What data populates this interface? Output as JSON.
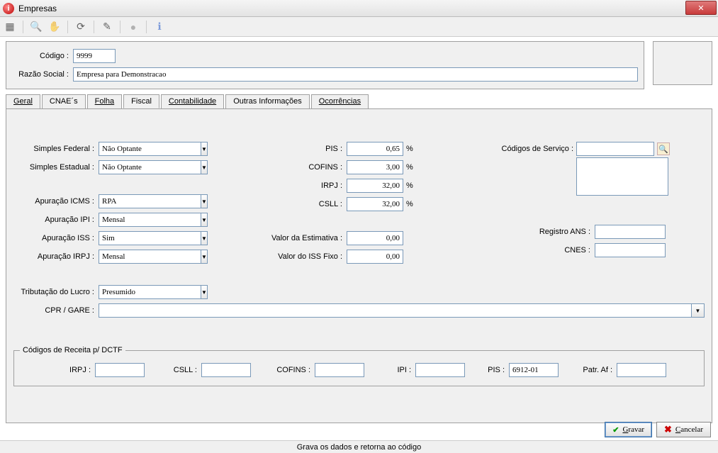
{
  "window": {
    "title": "Empresas",
    "icon_letter": "i"
  },
  "header": {
    "codigo_label": "Código :",
    "codigo_value": "9999",
    "razao_label": "Razão Social :",
    "razao_value": "Empresa para Demonstracao"
  },
  "tabs": {
    "geral": "Geral",
    "cnaes": "CNAE´s",
    "folha": "Folha",
    "fiscal": "Fiscal",
    "contabilidade": "Contabilidade",
    "outras": "Outras Informações",
    "ocorrencias": "Ocorrências"
  },
  "fiscal": {
    "simples_federal_label": "Simples Federal :",
    "simples_federal_value": "Não Optante",
    "simples_estadual_label": "Simples Estadual :",
    "simples_estadual_value": "Não Optante",
    "apuracao_icms_label": "Apuração ICMS :",
    "apuracao_icms_value": "RPA",
    "apuracao_ipi_label": "Apuração IPI :",
    "apuracao_ipi_value": "Mensal",
    "apuracao_iss_label": "Apuração ISS :",
    "apuracao_iss_value": "Sim",
    "apuracao_irpj_label": "Apuração IRPJ :",
    "apuracao_irpj_value": "Mensal",
    "pis_label": "PIS :",
    "pis_value": "0,65",
    "cofins_label": "COFINS :",
    "cofins_value": "3,00",
    "irpj_label": "IRPJ :",
    "irpj_value": "32,00",
    "csll_label": "CSLL :",
    "csll_value": "32,00",
    "pct": "%",
    "valor_estimativa_label": "Valor da Estimativa :",
    "valor_estimativa_value": "0,00",
    "valor_iss_fixo_label": "Valor do ISS Fixo :",
    "valor_iss_fixo_value": "0,00",
    "codigos_servico_label": "Códigos de Serviço :",
    "codigos_servico_value": "",
    "registro_ans_label": "Registro ANS :",
    "registro_ans_value": "",
    "cnes_label": "CNES :",
    "cnes_value": "",
    "tributacao_lucro_label": "Tributação do Lucro :",
    "tributacao_lucro_value": "Presumido",
    "cpr_gare_label": "CPR / GARE :",
    "cpr_gare_value": ""
  },
  "dctf": {
    "legend": "Códigos de Receita p/ DCTF",
    "irpj_label": "IRPJ :",
    "irpj_value": "",
    "csll_label": "CSLL :",
    "csll_value": "",
    "cofins_label": "COFINS :",
    "cofins_value": "",
    "ipi_label": "IPI :",
    "ipi_value": "",
    "pis_label": "PIS :",
    "pis_value": "6912-01",
    "patraf_label": "Patr. Af :",
    "patraf_value": ""
  },
  "buttons": {
    "gravar_prefix": "G",
    "gravar_rest": "ravar",
    "cancelar_prefix": "C",
    "cancelar_rest": "ancelar"
  },
  "status": {
    "text": "Grava os dados e retorna ao código"
  }
}
